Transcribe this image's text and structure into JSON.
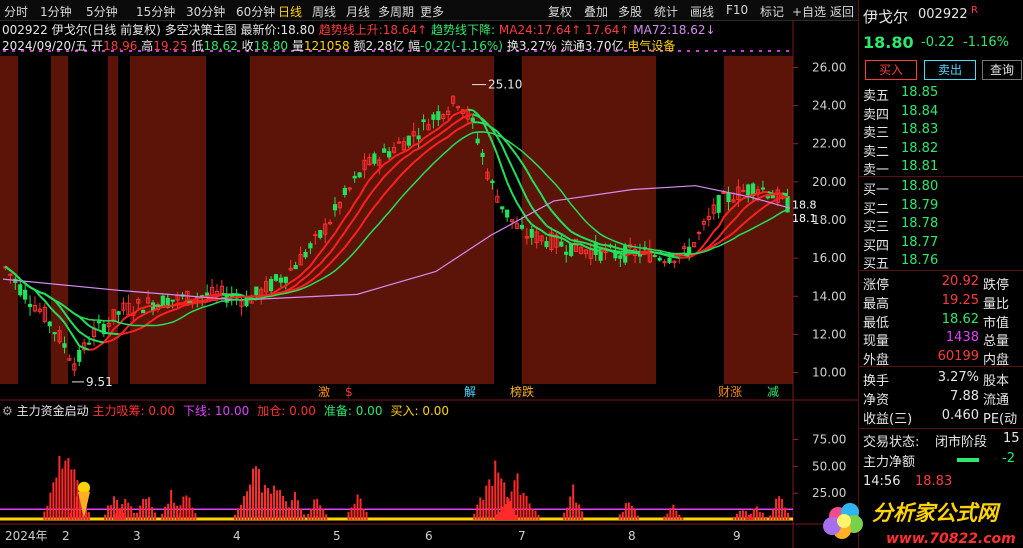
{
  "toolbar": {
    "items": [
      "分时",
      "1分钟",
      "5分钟",
      "15分钟",
      "30分钟",
      "60分钟",
      "日线",
      "周线",
      "月线",
      "多周期",
      "更多",
      "复权",
      "叠加",
      "多股",
      "统计",
      "画线",
      "F10",
      "标记",
      "+自选",
      "返回"
    ],
    "active": "日线"
  },
  "header": {
    "code_title": "002922 伊戈尔(日线 前复权)",
    "strategy": "多空决策主图",
    "latest_label": "最新价:",
    "latest_value": "18.80",
    "trend_up_label": "趋势线上升:",
    "trend_up_value": "18.64",
    "trend_down_label": "趋势线下降:",
    "ma24_label": "MA24:",
    "ma24_value": "17.64",
    "ma24_value2": "17.64",
    "ma72_label": "MA72:",
    "ma72_value": "18.62",
    "arrow_up": "↑",
    "arrow_down": "↓"
  },
  "info_line": {
    "date": "2024/09/20/五",
    "open_label": "开",
    "open": "18.96",
    "high_label": "高",
    "high": "19.25",
    "low_label": "低",
    "low": "18.62",
    "close_label": "收",
    "close": "18.80",
    "vol_label": "量",
    "vol": "121058",
    "amt_label": "额",
    "amt": "2.28亿",
    "chg_label": "幅",
    "chg": "-0.22(-1.16%)",
    "turn_label": "换",
    "turn": "3.27%",
    "float_label": "流通",
    "float": "3.70亿",
    "sector": "电气设备"
  },
  "chart_data": [
    {
      "type": "candlestick",
      "title": "002922 伊戈尔(日线 前复权)",
      "y_ticks": [
        "26.00",
        "24.00",
        "22.00",
        "20.00",
        "18.00",
        "16.00",
        "14.00",
        "12.00",
        "10.00"
      ],
      "ylim": [
        9.4,
        26.6
      ],
      "high_mark": "25.10",
      "low_mark": "9.51",
      "last_labels": [
        "18.8",
        "18.1"
      ],
      "month_labels": [
        "2024年",
        "2",
        "3",
        "4",
        "5",
        "6",
        "7",
        "8",
        "9"
      ],
      "series": [
        {
          "name": "趋势线",
          "color": "#ff2020"
        },
        {
          "name": "MA72",
          "color": "#d58cf0",
          "x": [
            0,
            0.15,
            0.3,
            0.45,
            0.55,
            0.62,
            0.7,
            0.8,
            0.88,
            0.95,
            1.0
          ],
          "values": [
            14.9,
            14.3,
            13.8,
            14.1,
            15.3,
            17.2,
            19.0,
            19.6,
            19.8,
            19.2,
            18.62
          ]
        }
      ],
      "price_path": {
        "x": [
          0,
          0.02,
          0.05,
          0.07,
          0.09,
          0.11,
          0.13,
          0.15,
          0.18,
          0.21,
          0.25,
          0.28,
          0.31,
          0.33,
          0.36,
          0.4,
          0.43,
          0.46,
          0.49,
          0.52,
          0.55,
          0.58,
          0.6,
          0.62,
          0.64,
          0.66,
          0.69,
          0.72,
          0.75,
          0.78,
          0.81,
          0.84,
          0.87,
          0.9,
          0.91,
          0.93,
          0.96,
          0.98,
          1.0
        ],
        "values": [
          15.5,
          14.4,
          13.0,
          11.8,
          10.4,
          12.0,
          12.6,
          13.3,
          13.6,
          13.8,
          14.0,
          14.1,
          13.8,
          14.3,
          15.2,
          17.0,
          19.0,
          20.8,
          21.6,
          22.4,
          23.5,
          24.3,
          22.8,
          20.0,
          18.4,
          17.3,
          17.0,
          16.6,
          16.4,
          16.2,
          16.3,
          16.1,
          16.2,
          18.0,
          18.8,
          19.3,
          19.8,
          19.4,
          18.8
        ]
      },
      "event_labels": [
        "激",
        "$",
        "解",
        "榜跌",
        "财涨",
        "减"
      ]
    },
    {
      "type": "bar",
      "title": "主力资金启动",
      "y_ticks": [
        "75.00",
        "50.00",
        "25.00"
      ],
      "ylim": [
        0,
        95
      ],
      "legend": [
        {
          "label": "主力吸筹:",
          "value": "0.00",
          "color": "#ff3030"
        },
        {
          "label": "下线:",
          "value": "10.00",
          "color": "#e040fb"
        },
        {
          "label": "加仓:",
          "value": "0.00",
          "color": "#ff3030"
        },
        {
          "label": "准备:",
          "value": "0.00",
          "color": "#2ee86d"
        },
        {
          "label": "买入:",
          "value": "0.00",
          "color": "#ffd400"
        }
      ],
      "spike_groups": [
        {
          "center": 0.235,
          "peak": 82
        },
        {
          "center": 0.287,
          "peak": 30
        },
        {
          "center": 0.41,
          "peak": 30
        },
        {
          "center": 0.45,
          "peak": 30
        },
        {
          "center": 0.525,
          "peak": 30
        },
        {
          "center": 0.615,
          "peak": 30
        },
        {
          "center": 0.67,
          "peak": 30
        },
        {
          "center": 0.92,
          "peak": 56
        },
        {
          "center": 0.985,
          "peak": 44
        },
        {
          "center": 1.06,
          "peak": 30
        },
        {
          "center": 1.14,
          "peak": 30
        },
        {
          "center": 1.285,
          "peak": 30
        },
        {
          "center": 1.78,
          "peak": 58
        },
        {
          "center": 1.86,
          "peak": 44
        },
        {
          "center": 2.06,
          "peak": 34
        },
        {
          "center": 2.26,
          "peak": 25
        },
        {
          "center": 2.42,
          "peak": 15
        },
        {
          "center": 2.67,
          "peak": 12
        },
        {
          "center": 2.72,
          "peak": 15
        },
        {
          "center": 2.8,
          "peak": 28
        }
      ],
      "lower_line": 10
    }
  ],
  "right_panel": {
    "name": "伊戈尔",
    "code": "002922",
    "flag": "R",
    "price": "18.80",
    "change": "-0.22",
    "pct": "-1.16%",
    "buy_btn": "买入",
    "sell_btn": "卖出",
    "query_btn": "查询",
    "asks": [
      {
        "label": "卖五",
        "price": "18.85"
      },
      {
        "label": "卖四",
        "price": "18.84"
      },
      {
        "label": "卖三",
        "price": "18.83"
      },
      {
        "label": "卖二",
        "price": "18.82"
      },
      {
        "label": "卖一",
        "price": "18.81"
      }
    ],
    "bids": [
      {
        "label": "买一",
        "price": "18.80"
      },
      {
        "label": "买二",
        "price": "18.79"
      },
      {
        "label": "买三",
        "price": "18.78"
      },
      {
        "label": "买四",
        "price": "18.77"
      },
      {
        "label": "买五",
        "price": "18.76"
      }
    ],
    "stats": [
      {
        "label": "涨停",
        "value": "20.92",
        "label2": "跌停",
        "color": "#ff3b3b"
      },
      {
        "label": "最高",
        "value": "19.25",
        "label2": "量比",
        "color": "#ff3b3b"
      },
      {
        "label": "最低",
        "value": "18.62",
        "label2": "市值",
        "color": "#2ee86d"
      },
      {
        "label": "现量",
        "value": "1438",
        "label2": "总量",
        "color": "#e040fb"
      },
      {
        "label": "外盘",
        "value": "60199",
        "label2": "内盘",
        "color": "#ff3b3b"
      }
    ],
    "stats2": [
      {
        "label": "换手",
        "value": "3.27%",
        "label2": "股本"
      },
      {
        "label": "净资",
        "value": "7.88",
        "label2": "流通"
      },
      {
        "label": "收益(三)",
        "value": "0.460",
        "label2": "PE(动"
      }
    ],
    "trade_status_label": "交易状态:",
    "trade_status": "闭市阶段",
    "trade_status_num": "15",
    "net_label": "主力净额",
    "net_value": "-2",
    "time": "14:56",
    "time_price": "18.83"
  },
  "watermark": "70822.com 分析家公式网",
  "logo": {
    "text": "分析家公式网",
    "url": "www.70822.com"
  }
}
